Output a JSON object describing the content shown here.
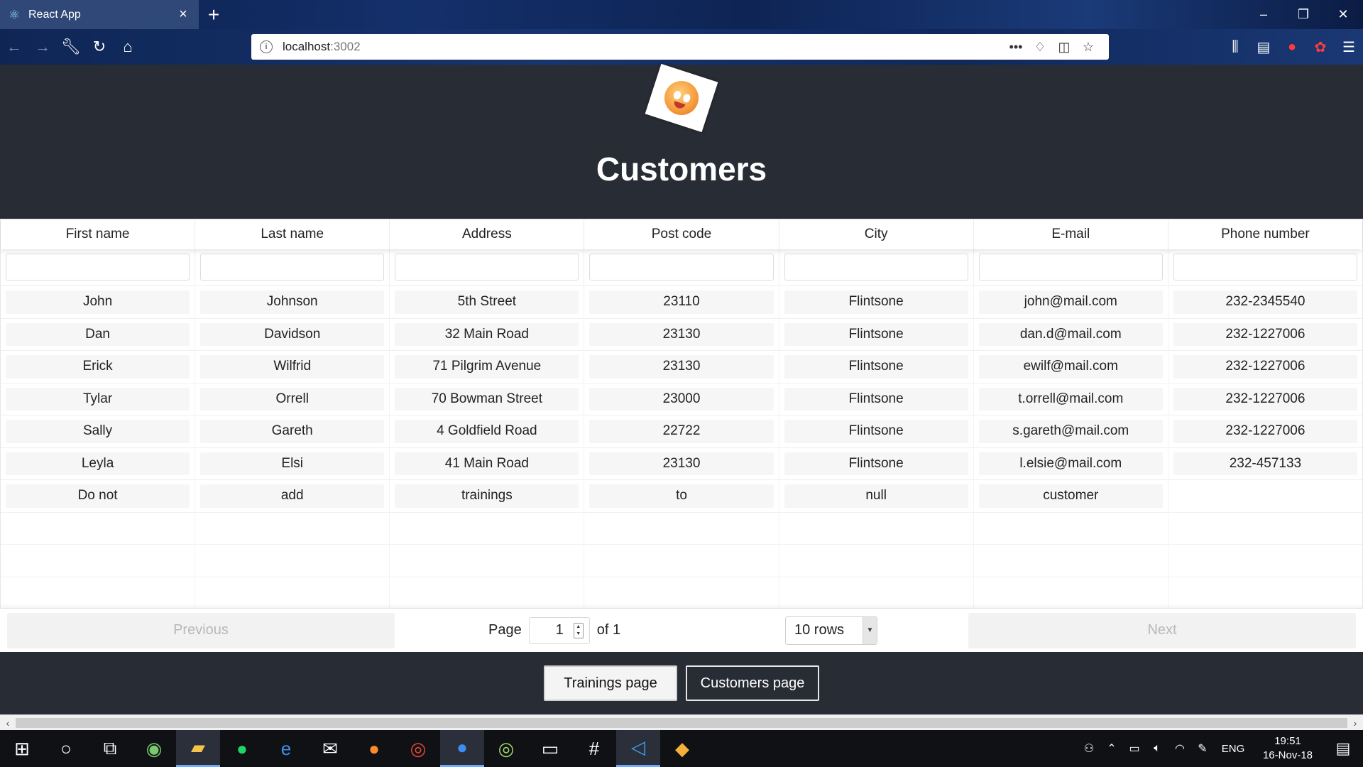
{
  "browser": {
    "tab_title": "React App",
    "new_tab_symbol": "+",
    "url_host": "localhost",
    "url_port": ":3002",
    "window_controls": {
      "minimize": "–",
      "restore": "❐",
      "close": "✕"
    }
  },
  "header": {
    "title": "Customers"
  },
  "table": {
    "columns": [
      "First name",
      "Last name",
      "Address",
      "Post code",
      "City",
      "E-mail",
      "Phone number"
    ],
    "rows": [
      [
        "John",
        "Johnson",
        "5th Street",
        "23110",
        "Flintsone",
        "john@mail.com",
        "232-2345540"
      ],
      [
        "Dan",
        "Davidson",
        "32 Main Road",
        "23130",
        "Flintsone",
        "dan.d@mail.com",
        "232-1227006"
      ],
      [
        "Erick",
        "Wilfrid",
        "71 Pilgrim Avenue",
        "23130",
        "Flintsone",
        "ewilf@mail.com",
        "232-1227006"
      ],
      [
        "Tylar",
        "Orrell",
        "70 Bowman Street",
        "23000",
        "Flintsone",
        "t.orrell@mail.com",
        "232-1227006"
      ],
      [
        "Sally",
        "Gareth",
        "4 Goldfield Road",
        "22722",
        "Flintsone",
        "s.gareth@mail.com",
        "232-1227006"
      ],
      [
        "Leyla",
        "Elsi",
        "41 Main Road",
        "23130",
        "Flintsone",
        "l.elsie@mail.com",
        "232-457133"
      ],
      [
        "Do not",
        "add",
        "trainings",
        "to",
        "null",
        "customer",
        ""
      ]
    ]
  },
  "pagination": {
    "previous_label": "Previous",
    "next_label": "Next",
    "page_label": "Page",
    "current_page": "1",
    "of_label": "of 1",
    "rows_option": "10 rows"
  },
  "footer": {
    "trainings_label": "Trainings page",
    "customers_label": "Customers page"
  },
  "taskbar": {
    "language": "ENG",
    "time": "19:51",
    "date": "16-Nov-18"
  }
}
